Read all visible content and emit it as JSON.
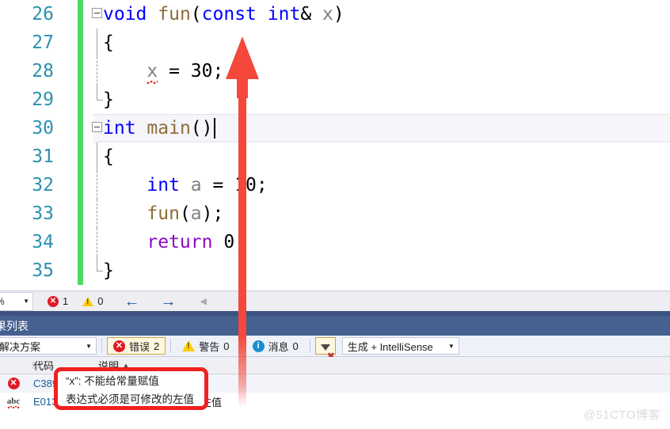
{
  "editor": {
    "lines": [
      {
        "number": "26",
        "indent": 0,
        "changed": true,
        "fold": "open",
        "highlight": false,
        "tokens": [
          {
            "t": "void",
            "c": "kw"
          },
          {
            "t": " ",
            "c": "plain"
          },
          {
            "t": "fun",
            "c": "fn"
          },
          {
            "t": "(",
            "c": "plain"
          },
          {
            "t": "const",
            "c": "kw"
          },
          {
            "t": " ",
            "c": "plain"
          },
          {
            "t": "int",
            "c": "kw"
          },
          {
            "t": "& ",
            "c": "plain"
          },
          {
            "t": "x",
            "c": "var"
          },
          {
            "t": ")",
            "c": "plain"
          }
        ]
      },
      {
        "number": "27",
        "indent": 0,
        "changed": true,
        "fold": "line",
        "highlight": false,
        "tokens": [
          {
            "t": "{",
            "c": "plain"
          }
        ]
      },
      {
        "number": "28",
        "indent": 0,
        "changed": true,
        "fold": "dashed",
        "highlight": false,
        "tokens": [
          {
            "t": "    ",
            "c": "plain"
          },
          {
            "t": "x",
            "c": "var squiggle"
          },
          {
            "t": " = ",
            "c": "plain"
          },
          {
            "t": "30",
            "c": "num"
          },
          {
            "t": ";",
            "c": "plain"
          }
        ]
      },
      {
        "number": "29",
        "indent": 0,
        "changed": true,
        "fold": "end",
        "highlight": false,
        "tokens": [
          {
            "t": "}",
            "c": "plain"
          }
        ]
      },
      {
        "number": "30",
        "indent": 0,
        "changed": true,
        "fold": "open",
        "highlight": true,
        "tokens": [
          {
            "t": "int",
            "c": "kw"
          },
          {
            "t": " ",
            "c": "plain"
          },
          {
            "t": "main",
            "c": "fn"
          },
          {
            "t": "()",
            "c": "plain"
          },
          {
            "t": "__caret__",
            "c": "caret"
          }
        ]
      },
      {
        "number": "31",
        "indent": 0,
        "changed": true,
        "fold": "line",
        "highlight": false,
        "tokens": [
          {
            "t": "{",
            "c": "plain"
          }
        ]
      },
      {
        "number": "32",
        "indent": 0,
        "changed": true,
        "fold": "dashed",
        "highlight": false,
        "tokens": [
          {
            "t": "    ",
            "c": "plain"
          },
          {
            "t": "int",
            "c": "kw"
          },
          {
            "t": " ",
            "c": "plain"
          },
          {
            "t": "a",
            "c": "var"
          },
          {
            "t": " = ",
            "c": "plain"
          },
          {
            "t": "10",
            "c": "num"
          },
          {
            "t": ";",
            "c": "plain"
          }
        ]
      },
      {
        "number": "33",
        "indent": 0,
        "changed": true,
        "fold": "dashed",
        "highlight": false,
        "tokens": [
          {
            "t": "    ",
            "c": "plain"
          },
          {
            "t": "fun",
            "c": "fn"
          },
          {
            "t": "(",
            "c": "plain"
          },
          {
            "t": "a",
            "c": "var"
          },
          {
            "t": ");",
            "c": "plain"
          }
        ]
      },
      {
        "number": "34",
        "indent": 0,
        "changed": true,
        "fold": "dashed",
        "highlight": false,
        "tokens": [
          {
            "t": "    ",
            "c": "plain"
          },
          {
            "t": "return",
            "c": "pp"
          },
          {
            "t": " ",
            "c": "plain"
          },
          {
            "t": "0",
            "c": "num"
          },
          {
            "t": ";",
            "c": "plain"
          }
        ]
      },
      {
        "number": "35",
        "indent": 0,
        "changed": true,
        "fold": "end",
        "highlight": false,
        "tokens": [
          {
            "t": "}",
            "c": "plain"
          }
        ]
      }
    ]
  },
  "editor_statusbar": {
    "zoom_value": "%",
    "error_count": "1",
    "warning_count": "0",
    "back_arrow": "←",
    "forward_arrow": "→",
    "collapse_arrow": "◀"
  },
  "panel": {
    "tab_label": "果列表",
    "toolbar": {
      "scope_value": "个解决方案",
      "errors_label": "错误",
      "errors_count": "2",
      "warnings_label": "警告",
      "warnings_count": "0",
      "messages_label": "消息",
      "messages_count": "0",
      "filter_icon": "filter-clear-icon",
      "build_value": "生成 + IntelliSense"
    },
    "columns": {
      "icon": "",
      "selector": "⬚",
      "code": "代码",
      "description": "说明",
      "sort_caret": "▲"
    },
    "rows": [
      {
        "icon": "error-icon",
        "code": "C3892",
        "description": "“x”: 不能给常量赋值"
      },
      {
        "icon": "intellisense-icon",
        "code": "E0137",
        "description": "表达式必须是可修改的左值"
      }
    ]
  },
  "annotations": {
    "arrow": {
      "color": "#f4483c",
      "name": "red-up-arrow"
    },
    "highlight_box": {
      "color": "#f02020",
      "lines": [
        "“x”: 不能给常量赋值",
        "表达式必须是可修改的左值"
      ]
    }
  },
  "watermark": {
    "text": "@51CTO博客"
  }
}
